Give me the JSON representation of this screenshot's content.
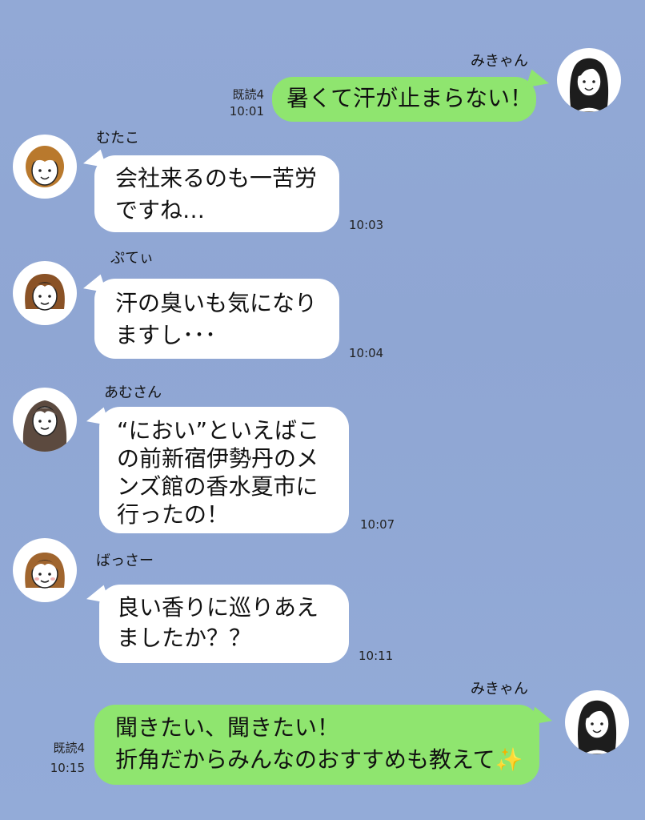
{
  "messages": [
    {
      "sender": "みきゃん",
      "read": "既読4",
      "time": "10:01",
      "text": "暑くて汗が止まらない！"
    },
    {
      "sender": "むたこ",
      "time": "10:03",
      "text": "会社来るのも一苦労\nですね…"
    },
    {
      "sender": "ぷてぃ",
      "time": "10:04",
      "text": "汗の臭いも気になり\nますし･･･"
    },
    {
      "sender": "あむさん",
      "time": "10:07",
      "text": "“におい”といえばこ\nの前新宿伊勢丹のメ\nンズ館の香水夏市に\n行ったの！"
    },
    {
      "sender": "ばっさー",
      "time": "10:11",
      "text": "良い香りに巡りあえ\nましたか？？"
    },
    {
      "sender": "みきゃん",
      "read": "既読4",
      "time": "10:15",
      "text": "聞きたい、聞きたい！\n折角だからみんなのおすすめも教えて✨"
    }
  ],
  "colors": {
    "background": "#92a9d6",
    "outgoing_bubble": "#8fe56f",
    "incoming_bubble": "#ffffff"
  }
}
